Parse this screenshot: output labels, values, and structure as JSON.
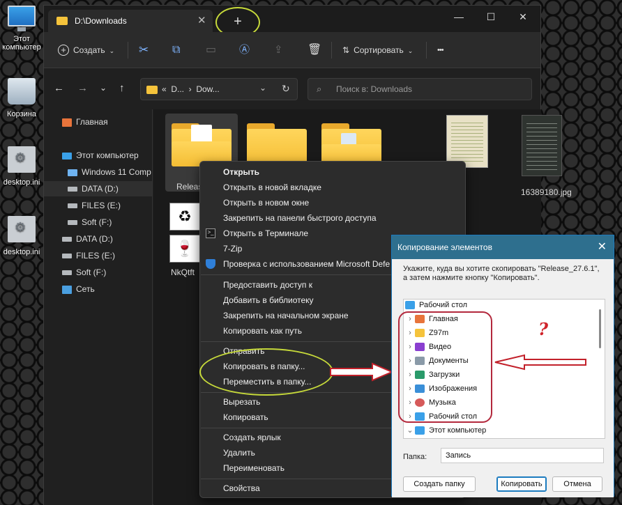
{
  "desktop": {
    "icons": [
      {
        "label": "Этот компьютер"
      },
      {
        "label": "Корзина"
      },
      {
        "label": "desktop.ini"
      },
      {
        "label": "desktop.ini"
      }
    ]
  },
  "explorer": {
    "tab_title": "D:\\Downloads",
    "new_tab": "+",
    "toolbar": {
      "create": "Создать",
      "sort": "Сортировать",
      "more": "•••"
    },
    "address": {
      "path": "«  D...  ›  Dow..."
    },
    "search": {
      "placeholder": "Поиск в: Downloads"
    },
    "sidebar": {
      "home": "Главная",
      "this_pc": "Этот компьютер",
      "windows": "Windows 11 Comp",
      "data": "DATA (D:)",
      "files": "FILES (E:)",
      "soft": "Soft (F:)",
      "data2": "DATA (D:)",
      "files2": "FILES (E:)",
      "soft2": "Soft (F:)",
      "network": "Сеть"
    },
    "files": {
      "release": "Release",
      "jpg": "16389180.jpg",
      "nkq": "NkQtft"
    }
  },
  "context_menu": {
    "items": [
      "Открыть",
      "Открыть в новой вкладке",
      "Открыть в новом окне",
      "Закрепить на панели быстрого доступа",
      "Открыть в Терминале",
      "7-Zip",
      "Проверка с использованием Microsoft Defe",
      "Предоставить доступ к",
      "Добавить в библиотеку",
      "Закрепить на начальном экране",
      "Копировать как путь",
      "Отправить",
      "Копировать в папку...",
      "Переместить в папку...",
      "Вырезать",
      "Копировать",
      "Создать ярлык",
      "Удалить",
      "Переименовать",
      "Свойства"
    ]
  },
  "dialog": {
    "title": "Копирование элементов",
    "instruction": "Укажите, куда вы хотите скопировать \"Release_27.6.1\", а затем нажмите кнопку \"Копировать\".",
    "tree": [
      "Рабочий стол",
      "Главная",
      "Z97m",
      "Видео",
      "Документы",
      "Загрузки",
      "Изображения",
      "Музыка",
      "Рабочий стол",
      "Этот компьютер"
    ],
    "folder_label": "Папка:",
    "folder_value": "Запись",
    "btn_new_folder": "Создать папку",
    "btn_copy": "Копировать",
    "btn_cancel": "Отмена"
  },
  "annotation": {
    "question": "?"
  }
}
